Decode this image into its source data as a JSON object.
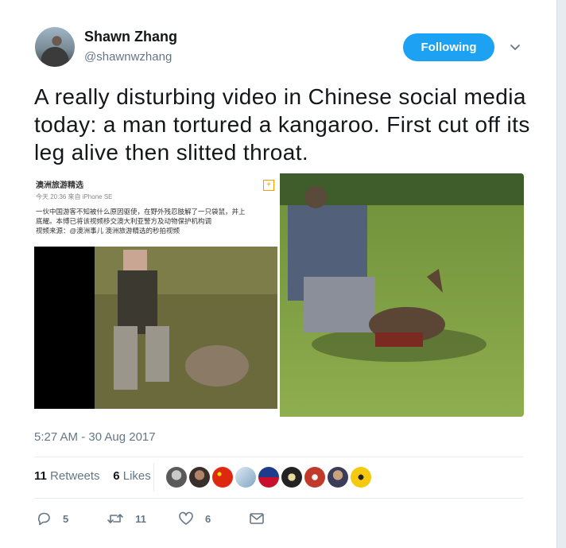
{
  "user": {
    "name": "Shawn Zhang",
    "handle": "@shawnwzhang"
  },
  "follow_button": {
    "label": "Following"
  },
  "tweet": {
    "text": "A really disturbing video in Chinese social media today: a man tortured a kangaroo. First cut off its leg alive then slitted throat."
  },
  "media": {
    "embedded_post": {
      "account": "澳洲旅游精选",
      "meta": "今天 20:36 来自 iPhone SE",
      "body_lines": [
        "一伙中国游客不知被什么原因驱使，在野外残忍肢解了一只袋鼠，并上",
        "底耀。本博已将该视频移交澳大利亚警方及动物保护机构调",
        "视频来源：@澳洲事儿 澳洲旅游精选的秒拍视频"
      ]
    }
  },
  "timestamp": "5:27 AM - 30 Aug 2017",
  "stats": {
    "retweets_count": "11",
    "retweets_label": "Retweets",
    "likes_count": "6",
    "likes_label": "Likes"
  },
  "actions": {
    "reply_count": "5",
    "retweet_count": "11",
    "like_count": "6"
  },
  "colors": {
    "accent": "#1da1f2",
    "muted": "#657786",
    "text": "#14171a"
  }
}
